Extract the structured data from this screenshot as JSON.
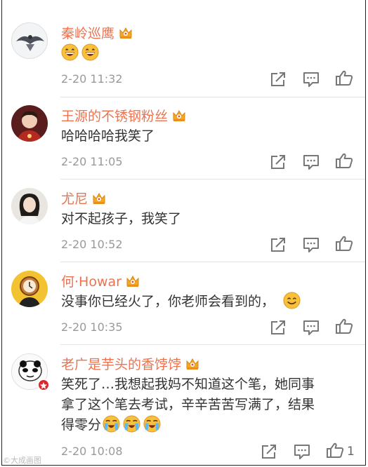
{
  "comments": [
    {
      "username": "秦岭巡鹰",
      "text": "",
      "emoji_count": 2,
      "emoji": "grin",
      "time": "2-20 11:32",
      "likes": ""
    },
    {
      "username": "王源的不锈钢粉丝",
      "text": "哈哈哈哈我笑了",
      "time": "2-20 11:05",
      "likes": ""
    },
    {
      "username": "尤尼",
      "text": "对不起孩子，我笑了",
      "time": "2-20 10:52",
      "likes": ""
    },
    {
      "username": "何·Howar",
      "text": "没事你已经火了，你老师会看到的，",
      "emoji": "smile",
      "time": "2-20 10:35",
      "likes": ""
    },
    {
      "username": "老广是芋头的香饽饽",
      "text_lines": [
        "笑死了…我想起我妈不知道这个笔，她同事",
        "拿了这个笔去考试，辛辛苦苦写满了，结果",
        "得零分"
      ],
      "emoji": "cry",
      "emoji_count": 3,
      "time": "2-20 10:08",
      "likes": "1"
    }
  ],
  "icons": {
    "share": "share-icon",
    "reply": "reply-icon",
    "like": "thumbs-up-icon",
    "crown": "vip-crown-icon"
  },
  "colors": {
    "username": "#eb7350",
    "text": "#333333",
    "time": "#999999",
    "crown": "#f5a623"
  },
  "watermark": "©大成画图"
}
